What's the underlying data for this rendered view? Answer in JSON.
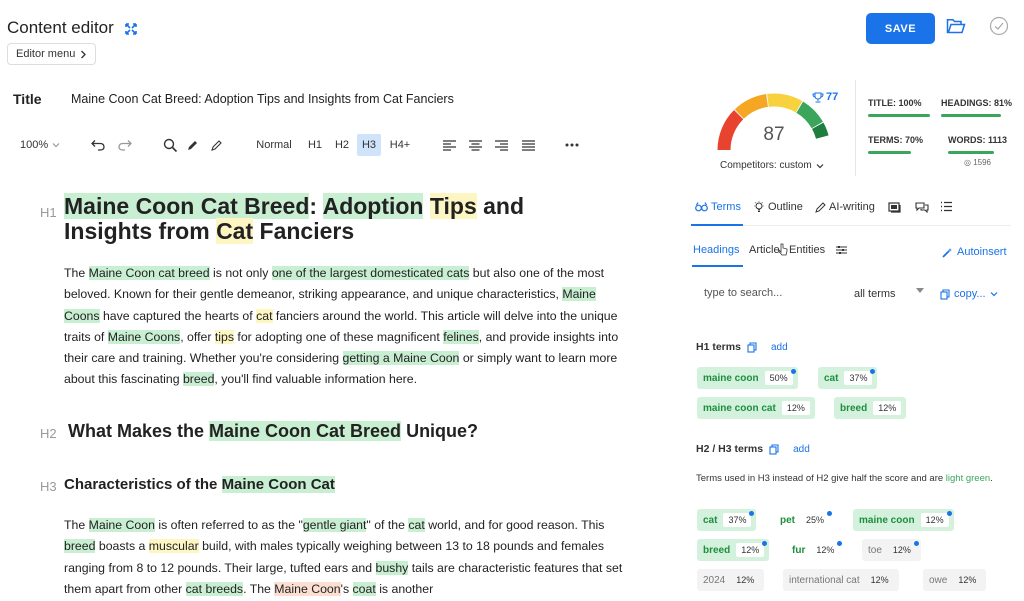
{
  "header": {
    "app_title": "Content editor",
    "editor_menu_label": "Editor menu",
    "save_label": "SAVE"
  },
  "title_field": {
    "label": "Title",
    "value": "Maine Coon Cat Breed: Adoption Tips and Insights from Cat Fanciers"
  },
  "toolbar": {
    "zoom": "100%",
    "headings": [
      "Normal",
      "H1",
      "H2",
      "H3",
      "H4+"
    ],
    "active_heading": "H3"
  },
  "doc": {
    "h1_tag": "H1",
    "h1_parts": [
      "Maine Coon Cat Breed",
      ": ",
      "Adoption",
      " ",
      "Tips",
      " and",
      "Insights from ",
      "Cat",
      " Fanciers"
    ],
    "p1": {
      "a": "The ",
      "b": "Maine Coon cat breed",
      "c": " is not only ",
      "d": "one of the largest domesticated cats",
      "e": " but also one of the most beloved. Known for their gentle demeanor, striking appearance, and unique characteristics, ",
      "f": "Maine Coons",
      "g": " have captured the hearts of ",
      "h": "cat",
      "i": " fanciers around the world. This article will delve into the unique traits of ",
      "j": "Maine Coons",
      "k": ", offer ",
      "l": "tips",
      "m": " for adopting one of these magnificent ",
      "n": "felines",
      "o": ", and provide insights into their care and training. Whether you're considering ",
      "p": "getting a Maine Coon",
      "q": " or simply want to learn more about this fascinating ",
      "r": "breed",
      "s": ", you'll find valuable information here."
    },
    "h2_tag": "H2",
    "h2": {
      "a": "What Makes the ",
      "b": "Maine Coon Cat Breed",
      "c": " Unique?"
    },
    "h3_tag": "H3",
    "h3": {
      "a": "Characteristics of the ",
      "b": "Maine Coon Cat"
    },
    "p2": {
      "a": "The ",
      "b": "Maine Coon",
      "c": " is often referred to as the \"",
      "d": "gentle giant",
      "e": "\" of the ",
      "f": "cat",
      "g": " world, and for good reason. This ",
      "h": "breed",
      "i": " boasts a ",
      "j": "muscular",
      "k": " build, with males typically weighing between 13 to 18 pounds and females ranging from 8 to 12 pounds. Their large, tufted ears and ",
      "l": "bushy",
      "m": " tails are characteristic features that set them apart from other ",
      "n": "cat breeds",
      "o": ". The ",
      "p": "Maine Coon",
      "q": "'s ",
      "r": "coat",
      "s": " is another"
    }
  },
  "score": {
    "value": "87",
    "trophy_value": "77",
    "competitors_label": "Competitors: custom",
    "gauge_colors": [
      "#e8432f",
      "#f5a623",
      "#f7d23e",
      "#3ba55c",
      "#1e7e3e"
    ]
  },
  "metrics": {
    "title": "TITLE: 100%",
    "headings": "HEADINGS: 81%",
    "terms": "TERMS: 70%",
    "words": "WORDS: 1113",
    "words_target": "1596",
    "title_fill": 1.0,
    "headings_fill": 0.81,
    "terms_fill": 0.7,
    "words_fill": 0.7
  },
  "tabs": [
    "Terms",
    "Outline",
    "AI-writing"
  ],
  "subtabs": [
    "Headings",
    "Article",
    "Entities"
  ],
  "autoinsert_label": "Autoinsert",
  "search": {
    "placeholder": "type to search...",
    "filter": "all terms",
    "copy_label": "copy..."
  },
  "h1_terms": {
    "label": "H1 terms",
    "add": "add",
    "chips": [
      {
        "term": "maine coon",
        "pct": "50%"
      },
      {
        "term": "cat",
        "pct": "37%"
      },
      {
        "term": "maine coon cat",
        "pct": "12%"
      },
      {
        "term": "breed",
        "pct": "12%"
      }
    ]
  },
  "h2h3_terms": {
    "label": "H2 / H3 terms",
    "add": "add",
    "note_a": "Terms used in H3 instead of H2 give half the score and are ",
    "note_b": "light green",
    "note_c": ".",
    "chips": [
      {
        "term": "cat",
        "pct": "37%"
      },
      {
        "term": "pet",
        "pct": "25%"
      },
      {
        "term": "maine coon",
        "pct": "12%"
      },
      {
        "term": "breed",
        "pct": "12%"
      },
      {
        "term": "fur",
        "pct": "12%"
      },
      {
        "term": "toe",
        "pct": "12%"
      },
      {
        "term": "2024",
        "pct": "12%"
      },
      {
        "term": "international cat",
        "pct": "12%"
      },
      {
        "term": "owe",
        "pct": "12%"
      }
    ]
  }
}
